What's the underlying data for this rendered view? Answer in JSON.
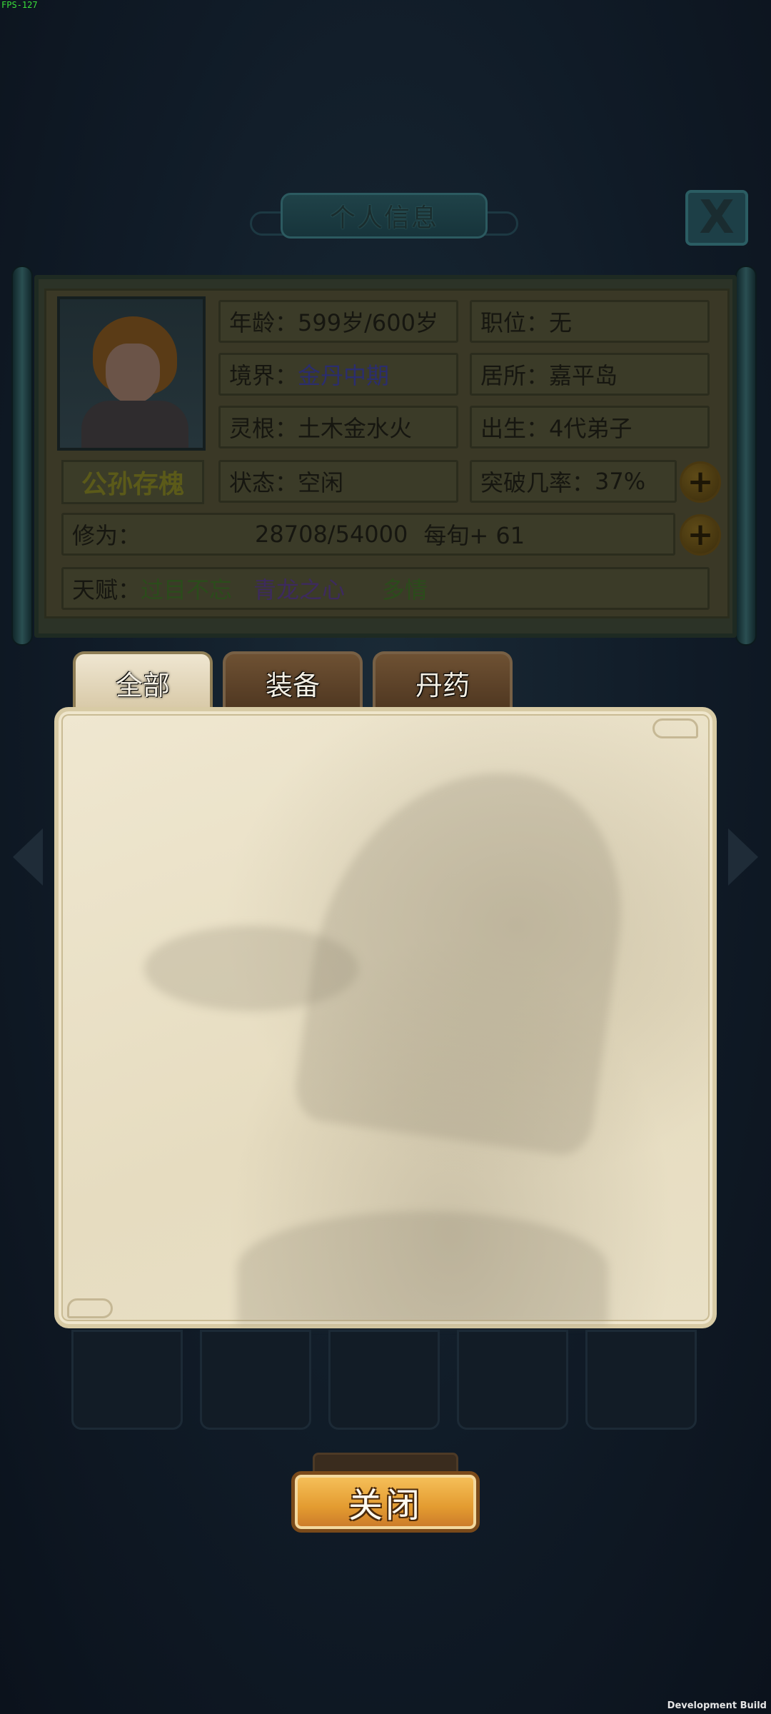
{
  "debug": {
    "fps": "FPS-127",
    "build_label": "Development Build"
  },
  "dialog": {
    "title": "个人信息",
    "close_icon_text": "X"
  },
  "character": {
    "name": "公孙存槐",
    "age_label": "年龄：",
    "age_value": "599岁/600岁",
    "position_label": "职位：",
    "position_value": "无",
    "realm_label": "境界：",
    "realm_value": "金丹中期",
    "residence_label": "居所：",
    "residence_value": "嘉平岛",
    "root_label": "灵根：",
    "root_value": "土木金水火",
    "origin_label": "出生：",
    "origin_value": "4代弟子",
    "status_label": "状态：",
    "status_value": "空闲",
    "breakthrough_label": "突破几率：",
    "breakthrough_value": "37%",
    "cultivation_label": "修为：",
    "cultivation_value": "28708/54000",
    "cultivation_rate": "每旬+ 61",
    "talent_label": "天赋：",
    "talents": [
      "过目不忘",
      "青龙之心",
      "多情"
    ]
  },
  "tabs": [
    "全部",
    "装备",
    "丹药"
  ],
  "active_tab": "全部",
  "footer": {
    "close_label": "关闭"
  },
  "colors": {
    "accent_gold": "#e39b30",
    "panel_paper": "#e9e0c6",
    "background": "#0d1622"
  }
}
